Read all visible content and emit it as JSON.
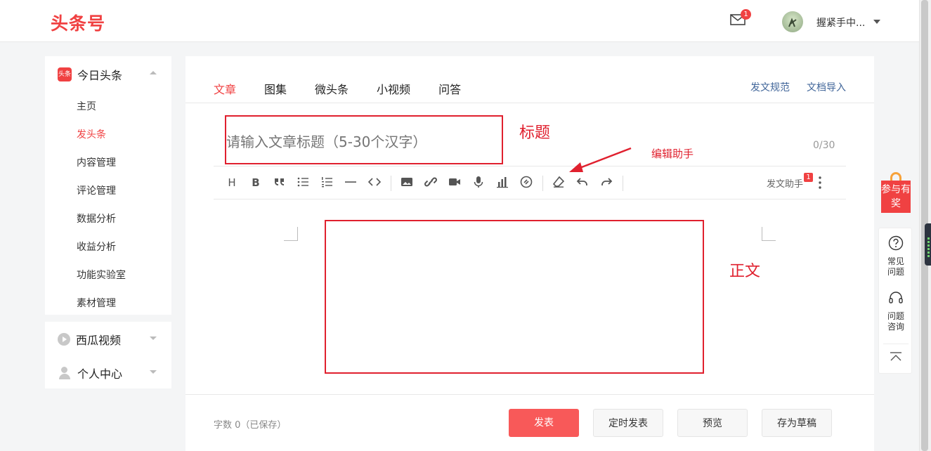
{
  "header": {
    "logo": "头条号",
    "mail_badge": "1",
    "username": "握紧手中..."
  },
  "sidebar": {
    "section1": {
      "title": "今日头条",
      "icon_text": "头条",
      "items": [
        "主页",
        "发头条",
        "内容管理",
        "评论管理",
        "数据分析",
        "收益分析",
        "功能实验室",
        "素材管理"
      ]
    },
    "section2": {
      "title": "西瓜视频"
    },
    "section3": {
      "title": "个人中心"
    }
  },
  "main": {
    "tabs": [
      "文章",
      "图集",
      "微头条",
      "小视频",
      "问答"
    ],
    "links": {
      "rules": "发文规范",
      "import": "文档导入"
    },
    "title_placeholder": "请输入文章标题（5-30个汉字）",
    "counter": "0/30",
    "helper_label": "发文助手",
    "helper_badge": "1",
    "word_count": "字数 0（已保存）",
    "buttons": {
      "publish": "发表",
      "schedule": "定时发表",
      "preview": "预览",
      "draft": "存为草稿"
    }
  },
  "annotations": {
    "title_label": "标题",
    "helper_label": "编辑助手",
    "body_label": "正文"
  },
  "float_panel": {
    "gift_text": "参与有奖",
    "faq": "常见问题",
    "consult": "问题咨询"
  },
  "colors": {
    "brand_red": "#f04142",
    "annotation_red": "#e0202e",
    "link_blue": "#406599"
  }
}
